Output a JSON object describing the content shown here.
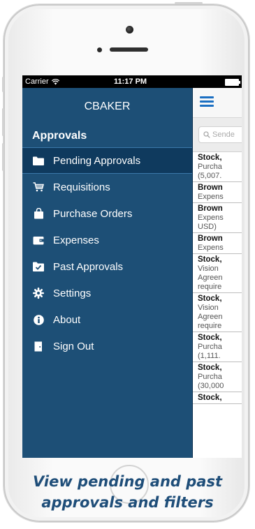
{
  "status_bar": {
    "carrier": "Carrier",
    "time": "11:17 PM"
  },
  "drawer": {
    "user": "CBAKER",
    "section": "Approvals",
    "items": [
      {
        "label": "Pending Approvals",
        "icon": "folder-icon",
        "active": true
      },
      {
        "label": "Requisitions",
        "icon": "cart-icon"
      },
      {
        "label": "Purchase Orders",
        "icon": "shopping-bag-icon"
      },
      {
        "label": "Expenses",
        "icon": "wallet-icon"
      },
      {
        "label": "Past Approvals",
        "icon": "folder-check-icon"
      },
      {
        "label": "Settings",
        "icon": "gear-icon"
      },
      {
        "label": "About",
        "icon": "info-icon"
      },
      {
        "label": "Sign Out",
        "icon": "sign-out-icon"
      }
    ]
  },
  "content": {
    "search_placeholder": "Sende",
    "rows": [
      {
        "title": "Stock,",
        "lines": [
          "Purcha",
          "(5,007."
        ]
      },
      {
        "title": "Brown",
        "lines": [
          "Expens"
        ]
      },
      {
        "title": "Brown",
        "lines": [
          "Expens",
          "USD)"
        ]
      },
      {
        "title": "Brown",
        "lines": [
          "Expens"
        ]
      },
      {
        "title": "Stock,",
        "lines": [
          "Vision",
          "Agreen",
          "require"
        ]
      },
      {
        "title": "Stock,",
        "lines": [
          "Vision",
          "Agreen",
          "require"
        ]
      },
      {
        "title": "Stock,",
        "lines": [
          "Purcha",
          "(1,111."
        ]
      },
      {
        "title": "Stock,",
        "lines": [
          "Purcha",
          "(30,000"
        ]
      },
      {
        "title": "Stock,",
        "lines": []
      }
    ]
  },
  "caption": {
    "line1": "View pending and past",
    "line2": "approvals and filters"
  },
  "colors": {
    "drawer_bg": "#1d4f76",
    "active_bg": "#0f3a5e",
    "accent": "#1b6fc2",
    "caption": "#1f4e79"
  }
}
